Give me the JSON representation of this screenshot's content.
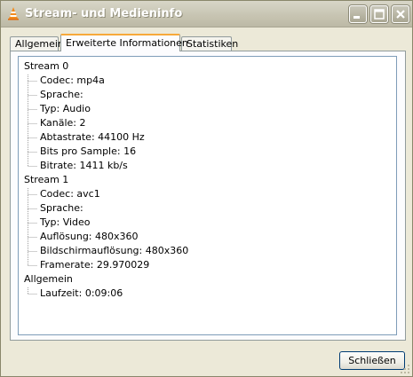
{
  "window": {
    "title": "Stream- und Medieninfo",
    "accent_color": "#f7a93a"
  },
  "tabs": [
    {
      "label": "Allgemein",
      "active": false
    },
    {
      "label": "Erweiterte Informationen",
      "active": true
    },
    {
      "label": "Statistiken",
      "active": false
    }
  ],
  "tree": [
    {
      "label": "Stream 0",
      "children": [
        "Codec: mp4a",
        "Sprache:",
        "Typ: Audio",
        "Kanäle: 2",
        "Abtastrate: 44100 Hz",
        "Bits pro Sample: 16",
        "Bitrate: 1411 kb/s"
      ]
    },
    {
      "label": "Stream 1",
      "children": [
        "Codec: avc1",
        "Sprache:",
        "Typ: Video",
        "Auflösung: 480x360",
        "Bildschirmauflösung: 480x360",
        "Framerate: 29.970029"
      ]
    },
    {
      "label": "Allgemein",
      "children": [
        "Laufzeit: 0:09:06"
      ]
    }
  ],
  "footer": {
    "close_label": "Schließen"
  }
}
